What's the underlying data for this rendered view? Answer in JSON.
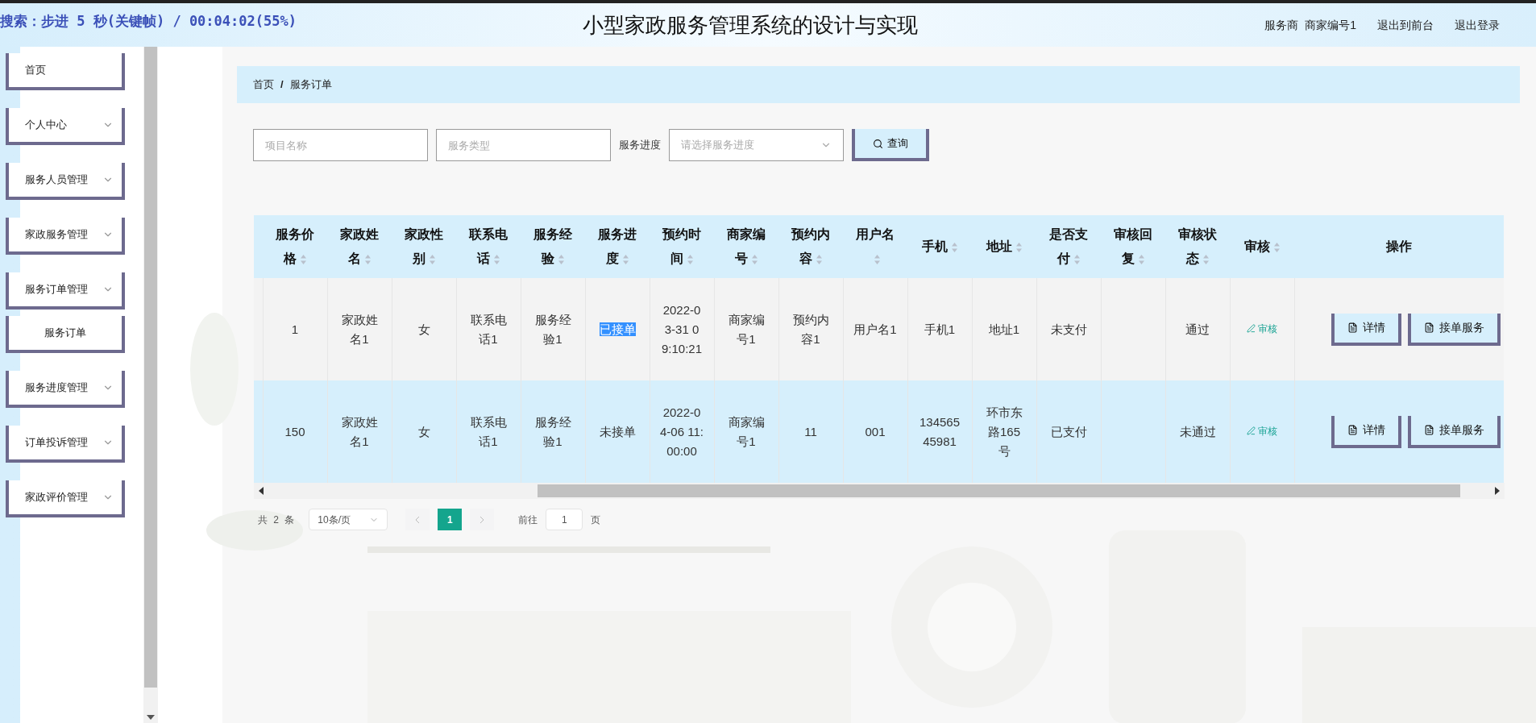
{
  "osd_text": "搜索：步进 5 秒(关键帧) / 00:04:02(55%)",
  "header": {
    "title": "小型家政服务管理系统的设计与实现",
    "role": "服务商",
    "user": "商家编号1",
    "links": [
      "退出到前台",
      "退出登录"
    ]
  },
  "sidebar": {
    "items": [
      {
        "label": "首页",
        "expandable": false
      },
      {
        "label": "个人中心",
        "expandable": true
      },
      {
        "label": "服务人员管理",
        "expandable": true
      },
      {
        "label": "家政服务管理",
        "expandable": true
      },
      {
        "label": "服务订单管理",
        "expandable": true,
        "children": [
          {
            "label": "服务订单"
          }
        ]
      },
      {
        "label": "服务进度管理",
        "expandable": true
      },
      {
        "label": "订单投诉管理",
        "expandable": true
      },
      {
        "label": "家政评价管理",
        "expandable": true
      }
    ]
  },
  "breadcrumb": [
    "首页",
    "服务订单"
  ],
  "breadcrumb_separator": "/",
  "search": {
    "fields": [
      {
        "placeholder": "项目名称"
      },
      {
        "placeholder": "服务类型"
      }
    ],
    "progress_label": "服务进度",
    "progress_select": {
      "placeholder": "请选择服务进度"
    },
    "button": "查询"
  },
  "table": {
    "columns": [
      {
        "label": "服务价格",
        "sortable": true
      },
      {
        "label": "家政姓名",
        "sortable": true
      },
      {
        "label": "家政性别",
        "sortable": true
      },
      {
        "label": "联系电话",
        "sortable": true
      },
      {
        "label": "服务经验",
        "sortable": true
      },
      {
        "label": "服务进度",
        "sortable": true
      },
      {
        "label": "预约时间",
        "sortable": true
      },
      {
        "label": "商家编号",
        "sortable": true
      },
      {
        "label": "预约内容",
        "sortable": true
      },
      {
        "label": "用户名",
        "sortable": true
      },
      {
        "label": "手机",
        "sortable": true
      },
      {
        "label": "地址",
        "sortable": true
      },
      {
        "label": "是否支付",
        "sortable": true
      },
      {
        "label": "审核回复",
        "sortable": true
      },
      {
        "label": "审核状态",
        "sortable": true
      },
      {
        "label": "审核",
        "sortable": true
      },
      {
        "label": "操作",
        "sortable": false
      }
    ],
    "rows": [
      {
        "cells": [
          "1",
          "家政姓名1",
          "女",
          "联系电话1",
          "服务经验1",
          "已接单",
          "2022-03-31 09:10:21",
          "商家编号1",
          "预约内容1",
          "用户名1",
          "手机1",
          "地址1",
          "未支付",
          null,
          "通过"
        ],
        "progress_text_selected": true,
        "audit_link": "审核",
        "actions": [
          "详情",
          "接单服务"
        ]
      },
      {
        "cells": [
          "150",
          "家政姓名1",
          "女",
          "联系电话1",
          "服务经验1",
          "未接单",
          "2022-04-06 11:00:00",
          "商家编号1",
          "11",
          "001",
          "13456545981",
          "环市东路165号",
          "已支付",
          null,
          "未通过"
        ],
        "progress_text_selected": false,
        "audit_link": "审核",
        "actions": [
          "详情",
          "接单服务"
        ]
      }
    ]
  },
  "pagination": {
    "total": "共 2 条",
    "page_size": "10条/页",
    "pages": [
      {
        "label": "1",
        "selected": true
      }
    ],
    "goto_label": "前往",
    "goto_value": "1",
    "goto_suffix": "页"
  }
}
